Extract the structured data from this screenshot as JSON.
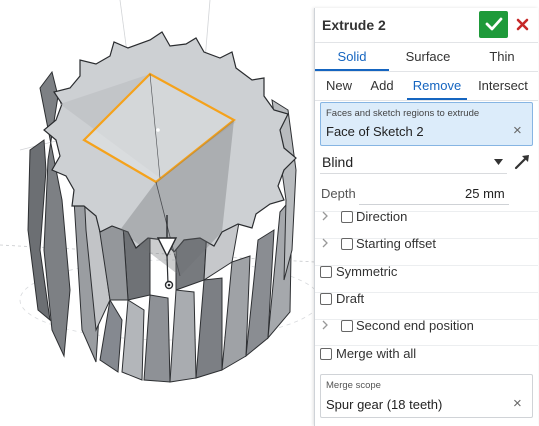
{
  "feature": {
    "title": "Extrude 2"
  },
  "tabs_type": [
    "Solid",
    "Surface",
    "Thin"
  ],
  "tabs_op": [
    "New",
    "Add",
    "Remove",
    "Intersect"
  ],
  "faces": {
    "label": "Faces and sketch regions to extrude",
    "value": "Face of Sketch 2",
    "clear": "×"
  },
  "end_type": "Blind",
  "depth": {
    "label": "Depth",
    "value": "25 mm"
  },
  "options": {
    "direction": "Direction",
    "starting_offset": "Starting offset",
    "symmetric": "Symmetric",
    "draft": "Draft",
    "second_end": "Second end position",
    "merge_with_all": "Merge with all"
  },
  "merge_scope": {
    "label": "Merge scope",
    "value": "Spur gear (18 teeth)",
    "clear": "×"
  },
  "colors": {
    "accent": "#1565c0",
    "ok": "#1e9a3a",
    "cancel": "#c62828",
    "highlight_fill": "#dcecfa",
    "sketch": "#f5a21b",
    "gear": "#8a8d91"
  },
  "icons": {
    "ok": "checkmark-icon",
    "cancel": "close-icon",
    "direction": "arrow-icon",
    "caret": "caret-down-icon",
    "chevron": "chevron-right-icon"
  }
}
